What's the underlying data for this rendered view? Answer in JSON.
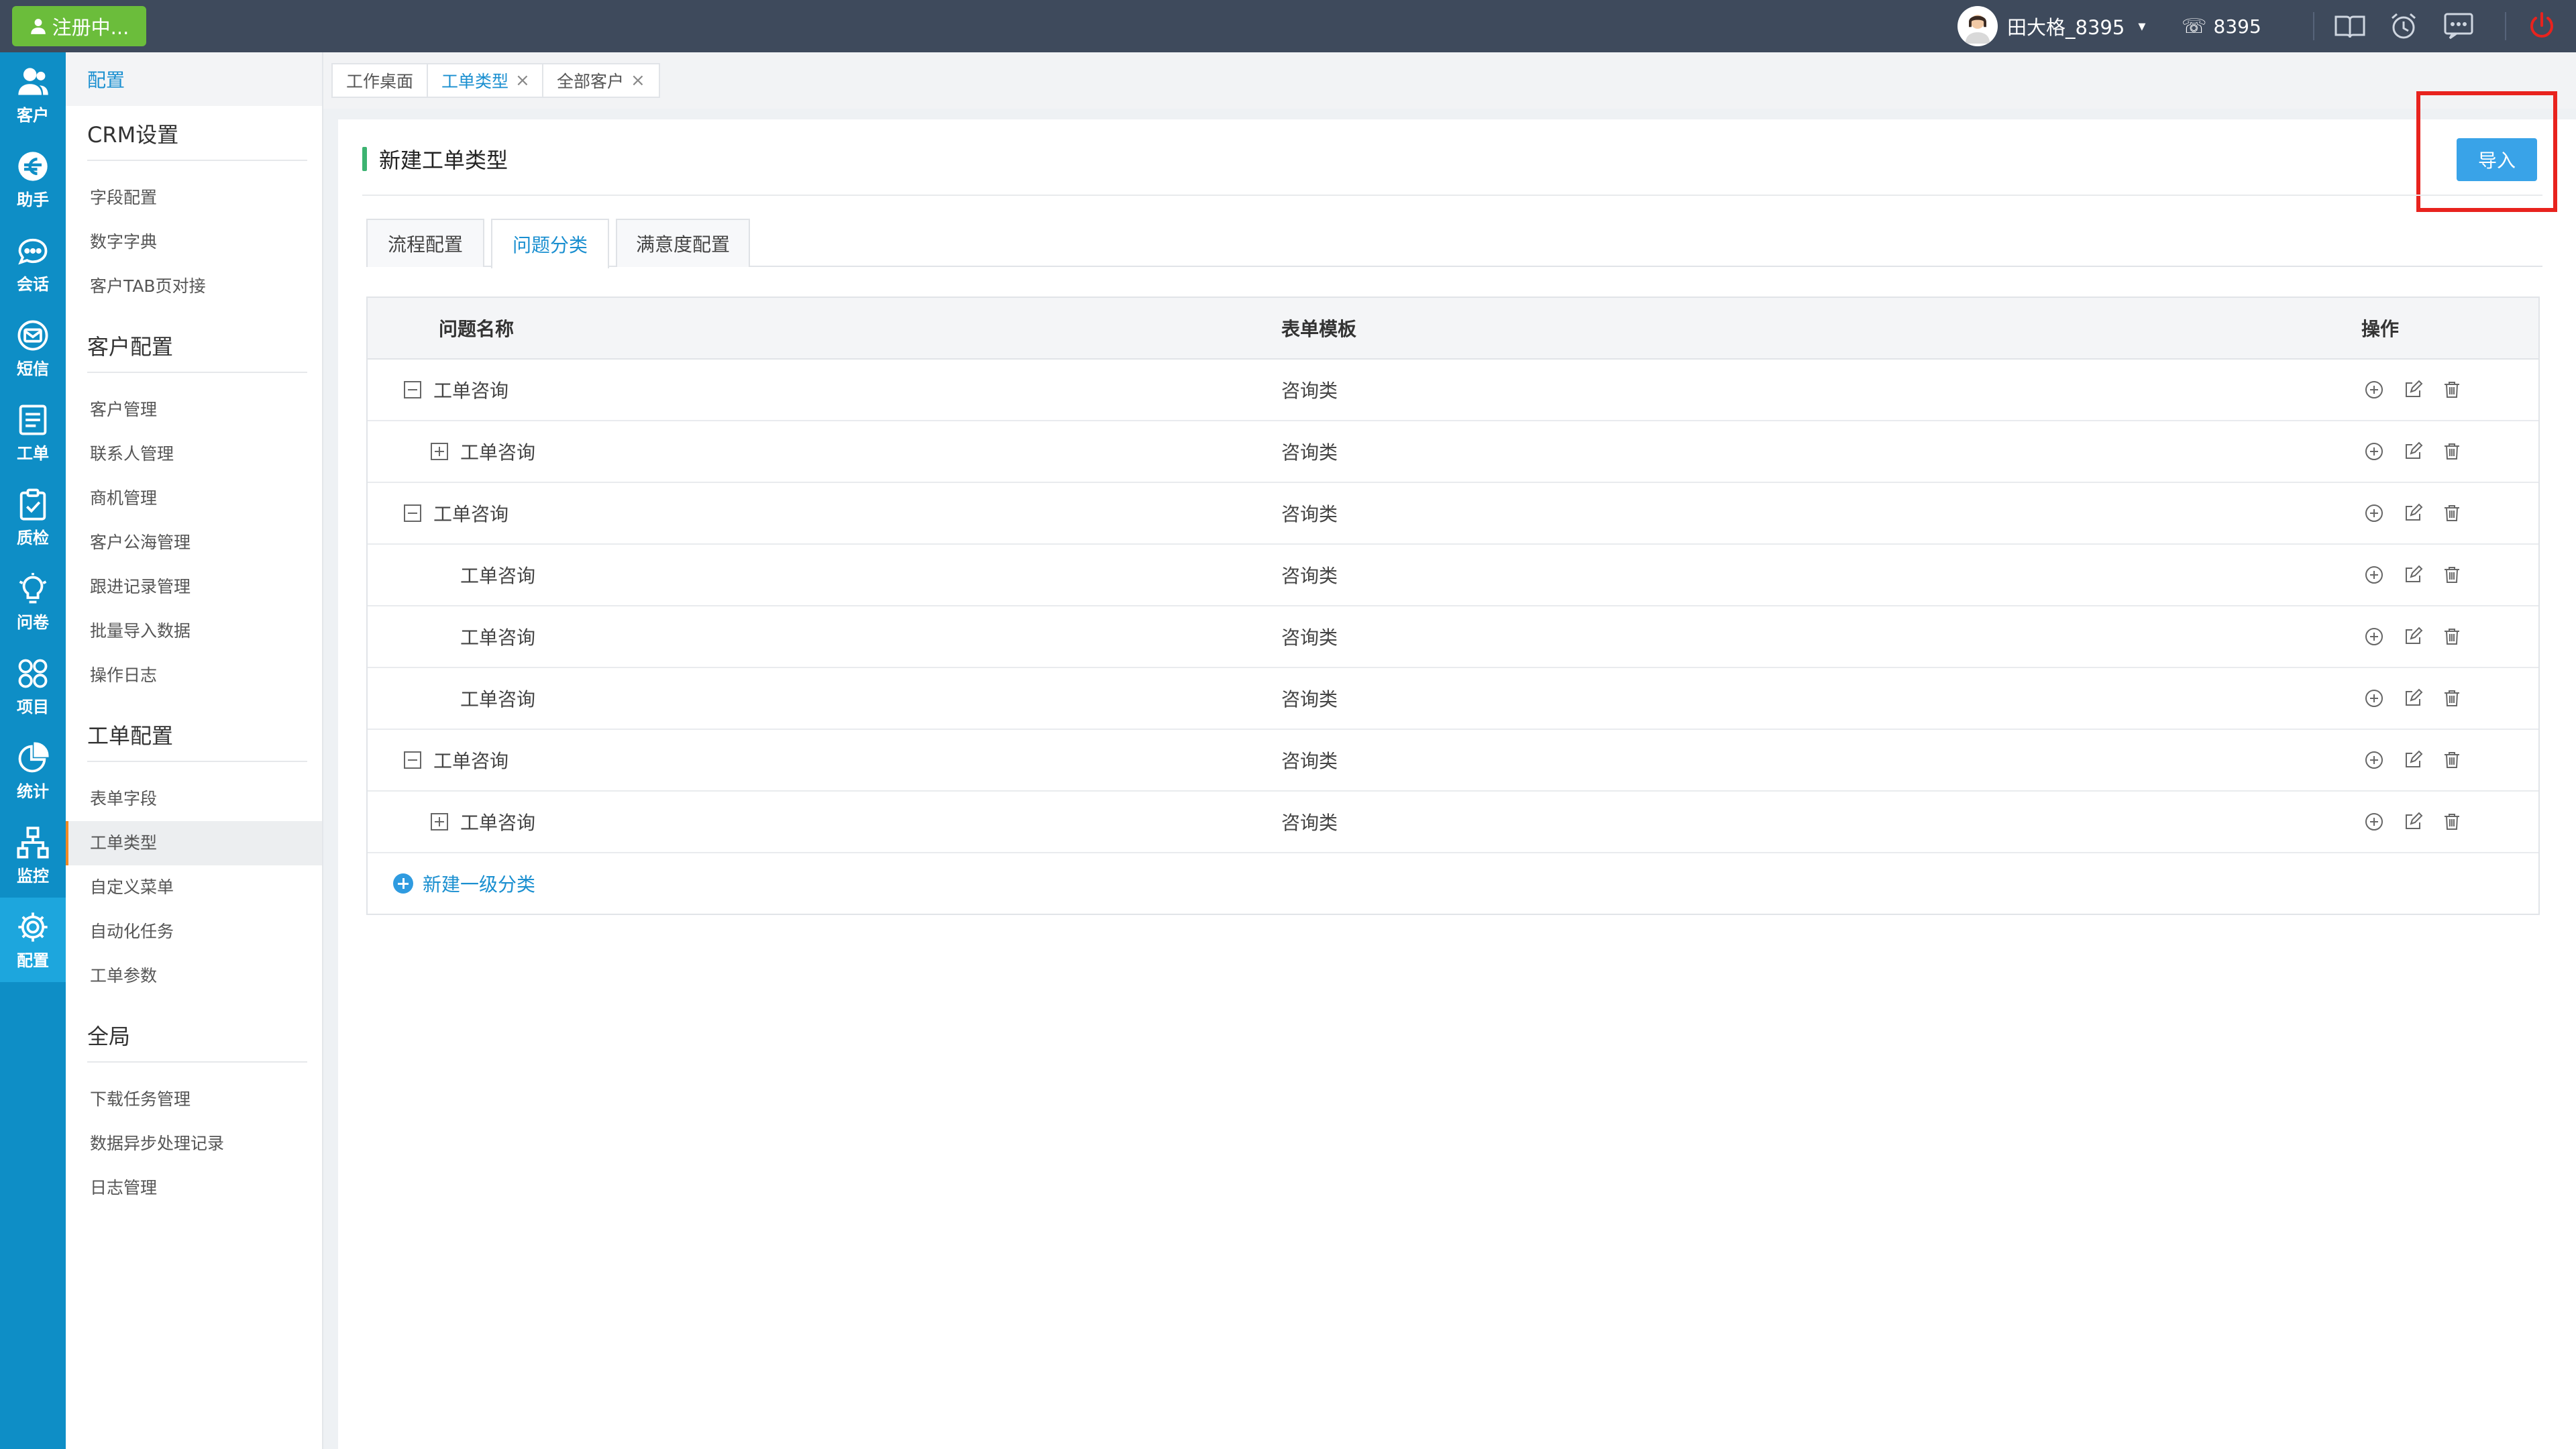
{
  "topbar": {
    "register_label": "注册中...",
    "user_name": "田大格_8395",
    "user_caret": "▾",
    "phone_glyph": "☏",
    "extension": "8395",
    "icons": [
      "book-icon",
      "alarm-clock-icon",
      "message-icon",
      "power-icon"
    ],
    "power_color": "#e8231e"
  },
  "rail": {
    "items": [
      {
        "label": "客户",
        "icon": "customer-icon"
      },
      {
        "label": "助手",
        "icon": "assistant-icon"
      },
      {
        "label": "会话",
        "icon": "chat-icon"
      },
      {
        "label": "短信",
        "icon": "sms-icon"
      },
      {
        "label": "工单",
        "icon": "ticket-icon"
      },
      {
        "label": "质检",
        "icon": "quality-check-icon"
      },
      {
        "label": "问卷",
        "icon": "survey-bulb-icon"
      },
      {
        "label": "项目",
        "icon": "project-icon"
      },
      {
        "label": "统计",
        "icon": "pie-chart-icon"
      },
      {
        "label": "监控",
        "icon": "monitor-icon"
      },
      {
        "label": "配置",
        "icon": "gear-icon"
      }
    ],
    "active_index": 10
  },
  "sidebar": {
    "header": "配置",
    "groups": [
      {
        "title": "CRM设置",
        "links": [
          "字段配置",
          "数字字典",
          "客户TAB页对接"
        ]
      },
      {
        "title": "客户配置",
        "links": [
          "客户管理",
          "联系人管理",
          "商机管理",
          "客户公海管理",
          "跟进记录管理",
          "批量导入数据",
          "操作日志"
        ]
      },
      {
        "title": "工单配置",
        "links": [
          "表单字段",
          "工单类型",
          "自定义菜单",
          "自动化任务",
          "工单参数"
        ]
      },
      {
        "title": "全局",
        "links": [
          "下载任务管理",
          "数据异步处理记录",
          "日志管理"
        ]
      }
    ],
    "active_link": "工单类型"
  },
  "page_tabs": [
    {
      "label": "工作桌面",
      "closable": false
    },
    {
      "label": "工单类型",
      "closable": true,
      "active": true
    },
    {
      "label": "全部客户",
      "closable": true
    }
  ],
  "page_tab_close_glyph": "×",
  "main": {
    "title": "新建工单类型",
    "import_label": "导入",
    "sub_tabs": [
      "流程配置",
      "问题分类",
      "满意度配置"
    ],
    "active_sub_tab": 1,
    "table": {
      "headers": {
        "name": "问题名称",
        "template": "表单模板",
        "ops": "操作"
      },
      "rows": [
        {
          "name": "工单咨询",
          "template": "咨询类",
          "level": 0,
          "toggle": "minus"
        },
        {
          "name": "工单咨询",
          "template": "咨询类",
          "level": 1,
          "toggle": "plus"
        },
        {
          "name": "工单咨询",
          "template": "咨询类",
          "level": 0,
          "toggle": "minus"
        },
        {
          "name": "工单咨询",
          "template": "咨询类",
          "level": 1,
          "toggle": "none"
        },
        {
          "name": "工单咨询",
          "template": "咨询类",
          "level": 1,
          "toggle": "none"
        },
        {
          "name": "工单咨询",
          "template": "咨询类",
          "level": 1,
          "toggle": "none"
        },
        {
          "name": "工单咨询",
          "template": "咨询类",
          "level": 0,
          "toggle": "minus"
        },
        {
          "name": "工单咨询",
          "template": "咨询类",
          "level": 1,
          "toggle": "plus"
        }
      ]
    },
    "add_category_label": "新建一级分类"
  }
}
